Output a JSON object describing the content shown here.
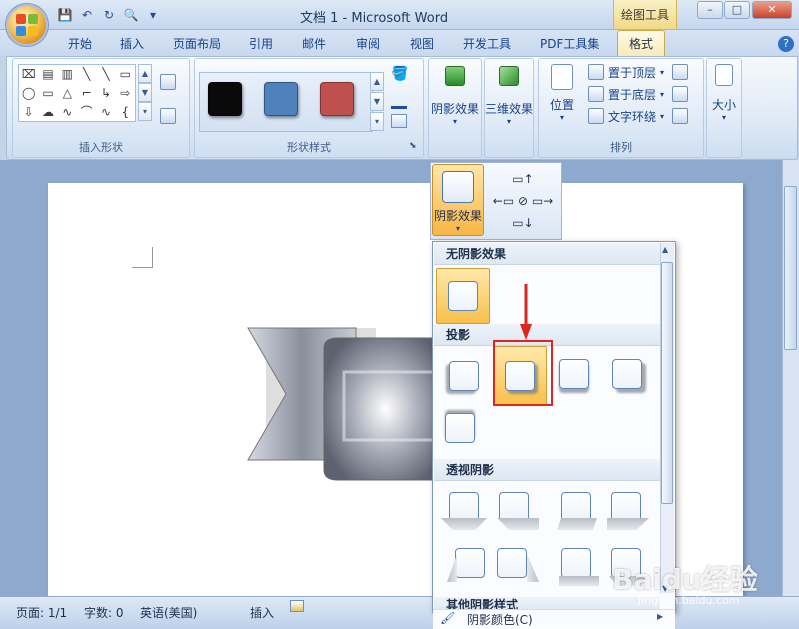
{
  "titlebar": {
    "title": "文档 1 - Microsoft Word",
    "context_tab_title": "绘图工具",
    "controls": {
      "minimize": "–",
      "maximize": "□",
      "close": "✕"
    }
  },
  "qat": {
    "save": "💾",
    "undo": "↶",
    "redo": "↻",
    "preview": "🔍",
    "more": "▾"
  },
  "tabs": [
    {
      "label": "开始"
    },
    {
      "label": "插入"
    },
    {
      "label": "页面布局"
    },
    {
      "label": "引用"
    },
    {
      "label": "邮件"
    },
    {
      "label": "审阅"
    },
    {
      "label": "视图"
    },
    {
      "label": "开发工具"
    },
    {
      "label": "PDF工具集"
    },
    {
      "label": "格式"
    }
  ],
  "help_icon": "?",
  "ribbon": {
    "insert_shapes": {
      "label": "插入形状",
      "shapes": [
        "⌧",
        "▤",
        "▥",
        "╲",
        "╲",
        "▭",
        "◯",
        "▭",
        "△",
        "⌐",
        "↳",
        "⇨",
        "⇩",
        "☁",
        "∿",
        "⌒",
        "∿",
        "{"
      ]
    },
    "shape_styles": {
      "label": "形状样式",
      "colors": {
        "black": "#0a0a0a",
        "blue": "#4f81bd",
        "red": "#c0504d"
      }
    },
    "shadow_effects": {
      "label": "阴影效果"
    },
    "threed_effects": {
      "label": "三维效果"
    },
    "arrange": {
      "label": "排列",
      "position": "位置",
      "bring_to_front": "置于顶层",
      "send_to_back": "置于底层",
      "text_wrap": "文字环绕"
    },
    "size": {
      "label": "大小"
    }
  },
  "shadow_button": {
    "label": "阴影效果"
  },
  "gallery": {
    "no_shadow": "无阴影效果",
    "drop_shadow": "投影",
    "perspective_shadow": "透视阴影",
    "other_shadow": "其他阴影样式",
    "shadow_color": "阴影颜色(C)"
  },
  "statusbar": {
    "page": "页面: 1/1",
    "words": "字数: 0",
    "language": "英语(美国)",
    "mode": "插入"
  },
  "watermark": {
    "brand": "Baidu经验",
    "url": "jingyan.baidu.com"
  }
}
